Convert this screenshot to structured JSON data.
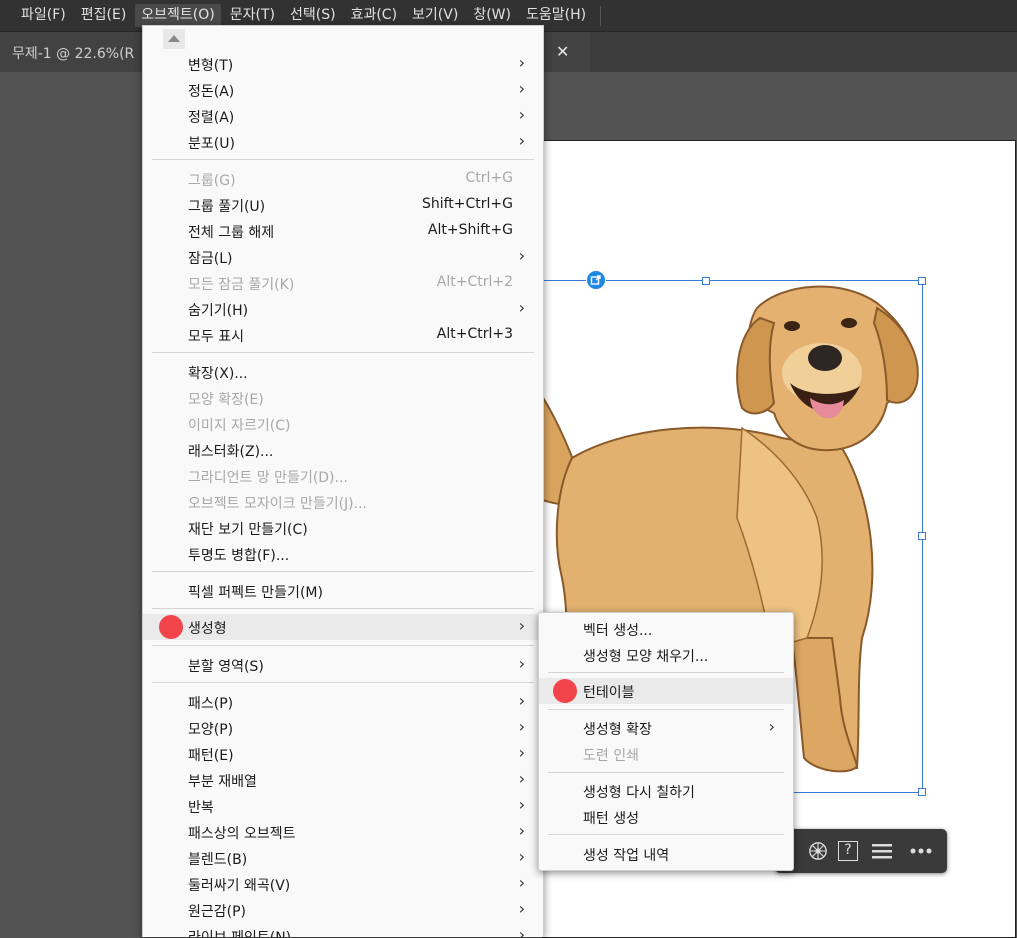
{
  "menubar": {
    "items": [
      "파일(F)",
      "편집(E)",
      "오브젝트(O)",
      "문자(T)",
      "선택(S)",
      "효과(C)",
      "보기(V)",
      "창(W)",
      "도움말(H)"
    ]
  },
  "doc_tab": {
    "title": "무제-1 @ 22.6%(R"
  },
  "object_menu": {
    "items": [
      {
        "label": "변형(T)",
        "shortcut": "",
        "submenu": true,
        "disabled": false
      },
      {
        "label": "정돈(A)",
        "shortcut": "",
        "submenu": true,
        "disabled": false
      },
      {
        "label": "정렬(A)",
        "shortcut": "",
        "submenu": true,
        "disabled": false
      },
      {
        "label": "분포(U)",
        "shortcut": "",
        "submenu": true,
        "disabled": false
      },
      {
        "label": "그룹(G)",
        "shortcut": "Ctrl+G",
        "submenu": false,
        "disabled": true
      },
      {
        "label": "그룹 풀기(U)",
        "shortcut": "Shift+Ctrl+G",
        "submenu": false,
        "disabled": false
      },
      {
        "label": "전체 그룹 해제",
        "shortcut": "Alt+Shift+G",
        "submenu": false,
        "disabled": false
      },
      {
        "label": "잠금(L)",
        "shortcut": "",
        "submenu": true,
        "disabled": false
      },
      {
        "label": "모든 잠금 풀기(K)",
        "shortcut": "Alt+Ctrl+2",
        "submenu": false,
        "disabled": true
      },
      {
        "label": "숨기기(H)",
        "shortcut": "",
        "submenu": true,
        "disabled": false
      },
      {
        "label": "모두 표시",
        "shortcut": "Alt+Ctrl+3",
        "submenu": false,
        "disabled": false
      },
      {
        "label": "확장(X)...",
        "shortcut": "",
        "submenu": false,
        "disabled": false
      },
      {
        "label": "모양 확장(E)",
        "shortcut": "",
        "submenu": false,
        "disabled": true
      },
      {
        "label": "이미지 자르기(C)",
        "shortcut": "",
        "submenu": false,
        "disabled": true
      },
      {
        "label": "래스터화(Z)...",
        "shortcut": "",
        "submenu": false,
        "disabled": false
      },
      {
        "label": "그라디언트 망 만들기(D)...",
        "shortcut": "",
        "submenu": false,
        "disabled": true
      },
      {
        "label": "오브젝트 모자이크 만들기(J)...",
        "shortcut": "",
        "submenu": false,
        "disabled": true
      },
      {
        "label": "재단 보기 만들기(C)",
        "shortcut": "",
        "submenu": false,
        "disabled": false
      },
      {
        "label": "투명도 병합(F)...",
        "shortcut": "",
        "submenu": false,
        "disabled": false
      },
      {
        "label": "픽셀 퍼펙트 만들기(M)",
        "shortcut": "",
        "submenu": false,
        "disabled": false
      },
      {
        "label": "생성형",
        "shortcut": "",
        "submenu": true,
        "disabled": false
      },
      {
        "label": "분할 영역(S)",
        "shortcut": "",
        "submenu": true,
        "disabled": false
      },
      {
        "label": "패스(P)",
        "shortcut": "",
        "submenu": true,
        "disabled": false
      },
      {
        "label": "모양(P)",
        "shortcut": "",
        "submenu": true,
        "disabled": false
      },
      {
        "label": "패턴(E)",
        "shortcut": "",
        "submenu": true,
        "disabled": false
      },
      {
        "label": "부분 재배열",
        "shortcut": "",
        "submenu": true,
        "disabled": false
      },
      {
        "label": "반복",
        "shortcut": "",
        "submenu": true,
        "disabled": false
      },
      {
        "label": "패스상의 오브젝트",
        "shortcut": "",
        "submenu": true,
        "disabled": false
      },
      {
        "label": "블렌드(B)",
        "shortcut": "",
        "submenu": true,
        "disabled": false
      },
      {
        "label": "둘러싸기 왜곡(V)",
        "shortcut": "",
        "submenu": true,
        "disabled": false
      },
      {
        "label": "원근감(P)",
        "shortcut": "",
        "submenu": true,
        "disabled": false
      },
      {
        "label": "라이브 페인트(N)",
        "shortcut": "",
        "submenu": true,
        "disabled": false
      }
    ]
  },
  "generative_submenu": {
    "items": [
      {
        "label": "벡터 생성...",
        "submenu": false,
        "disabled": false
      },
      {
        "label": "생성형 모양 채우기...",
        "submenu": false,
        "disabled": false
      },
      {
        "label": "턴테이블",
        "submenu": false,
        "disabled": false
      },
      {
        "label": "생성형 확장",
        "submenu": true,
        "disabled": false
      },
      {
        "label": "도련 인쇄",
        "submenu": false,
        "disabled": true
      },
      {
        "label": "생성형 다시 칠하기",
        "submenu": false,
        "disabled": false
      },
      {
        "label": "패턴 생성",
        "submenu": false,
        "disabled": false
      },
      {
        "label": "생성 작업 내역",
        "submenu": false,
        "disabled": false
      }
    ]
  },
  "context_taskbar": {
    "help": "?"
  },
  "colors": {
    "highlight_dot": "#f2454b",
    "selection": "#3a7bd5"
  }
}
